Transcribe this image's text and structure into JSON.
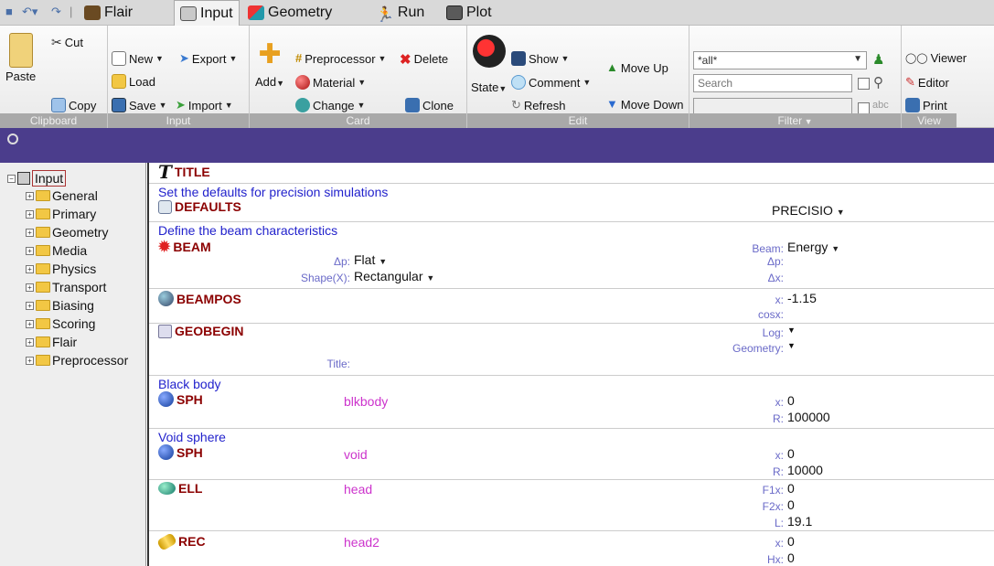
{
  "tabs": [
    {
      "label": "Flair"
    },
    {
      "label": "Input"
    },
    {
      "label": "Geometry"
    },
    {
      "label": "Run"
    },
    {
      "label": "Plot"
    }
  ],
  "clipboard": {
    "cut": "Cut",
    "paste": "Paste",
    "copy": "Copy",
    "footer": "Clipboard"
  },
  "input_group": {
    "new": "New",
    "export": "Export",
    "load": "Load",
    "save": "Save",
    "import": "Import",
    "footer": "Input"
  },
  "card_group": {
    "preprocessor": "Preprocessor",
    "delete": "Delete",
    "material": "Material",
    "add": "Add",
    "change": "Change",
    "clone": "Clone",
    "footer": "Card"
  },
  "edit_group": {
    "state": "State",
    "show": "Show",
    "comment": "Comment",
    "refresh": "Refresh",
    "move_up": "Move Up",
    "move_down": "Move Down",
    "footer": "Edit"
  },
  "filter_group": {
    "selected": "*all*",
    "search_placeholder": "Search",
    "footer": "Filter"
  },
  "view_group": {
    "viewer": "Viewer",
    "editor": "Editor",
    "print": "Print",
    "footer": "View"
  },
  "tree": {
    "root": "Input",
    "items": [
      "General",
      "Primary",
      "Geometry",
      "Media",
      "Physics",
      "Transport",
      "Biasing",
      "Scoring",
      "Flair",
      "Preprocessor"
    ]
  },
  "editor": {
    "title_card": "TITLE",
    "comment1": "Set the defaults for precision simulations",
    "defaults_card": "DEFAULTS",
    "defaults_value": "PRECISIO",
    "comment2": "Define the beam characteristics",
    "beam_card": "BEAM",
    "beam_label": "Beam:",
    "beam_value": "Energy",
    "dp_label": "Δp:",
    "dp_value": "Flat",
    "dp_label2": "Δp:",
    "shape_label": "Shape(X):",
    "shape_value": "Rectangular",
    "dx_label": "Δx:",
    "beampos_card": "BEAMPOS",
    "x_label": "x:",
    "x_value": "-1.15",
    "cosx_label": "cosx:",
    "geobegin_card": "GEOBEGIN",
    "log_label": "Log:",
    "geometry_label": "Geometry:",
    "title_label": "Title:",
    "comment3": "Black body",
    "sph1_card": "SPH",
    "sph1_name": "blkbody",
    "sph1_x_label": "x:",
    "sph1_x": "0",
    "sph1_r_label": "R:",
    "sph1_r": "100000",
    "comment4": "Void sphere",
    "sph2_card": "SPH",
    "sph2_name": "void",
    "sph2_x_label": "x:",
    "sph2_x": "0",
    "sph2_r_label": "R:",
    "sph2_r": "10000",
    "ell_card": "ELL",
    "ell_name": "head",
    "ell_f1x_label": "F1x:",
    "ell_f1x": "0",
    "ell_f2x_label": "F2x:",
    "ell_f2x": "0",
    "ell_l_label": "L:",
    "ell_l": "19.1",
    "rec_card": "REC",
    "rec_name": "head2",
    "rec_x_label": "x:",
    "rec_x": "0",
    "rec_hx_label": "Hx:",
    "rec_hx": "0"
  },
  "colors": {
    "accent_bar": "#4b3d8c",
    "card_name": "#8b0000",
    "comment": "#2222cc",
    "sdname": "#cc33cc"
  }
}
